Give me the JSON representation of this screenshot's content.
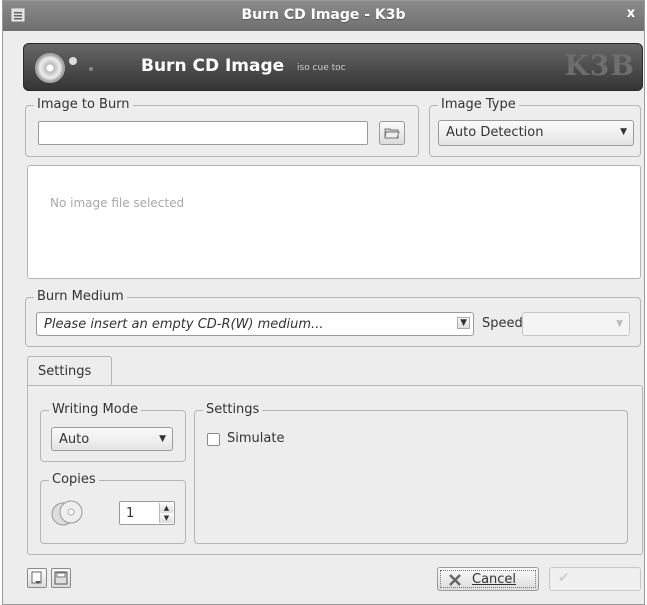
{
  "window": {
    "title": "Burn CD Image - K3b",
    "close_glyph": "x"
  },
  "header": {
    "title": "Burn CD Image",
    "subtitle": "iso cue toc",
    "logo": "K3B"
  },
  "image_to_burn": {
    "label": "Image to Burn",
    "value": ""
  },
  "image_type": {
    "label": "Image Type",
    "selected": "Auto Detection"
  },
  "info": {
    "message": "No image file selected"
  },
  "burn_medium": {
    "label": "Burn Medium",
    "selected": "Please insert an empty CD-R(W) medium...",
    "speed_label": "Speed:",
    "speed_value": ""
  },
  "tabs": [
    {
      "label": "Settings"
    }
  ],
  "writing_mode": {
    "label": "Writing Mode",
    "selected": "Auto"
  },
  "copies": {
    "label": "Copies",
    "value": "1"
  },
  "settings_group": {
    "label": "Settings",
    "simulate_label": "Simulate",
    "simulate_checked": false
  },
  "buttons": {
    "cancel": "Cancel",
    "burn_glyph": "✔"
  },
  "icons": [
    "menu-icon",
    "cd-icon",
    "folder-open-icon",
    "cd-copies-icon",
    "load-settings-icon",
    "save-settings-icon",
    "cancel-x-icon",
    "burn-check-icon"
  ],
  "colors": {
    "titlebar": "#7d7d7d",
    "header_bg": "#4a4a4a",
    "window_bg": "#ededed"
  }
}
